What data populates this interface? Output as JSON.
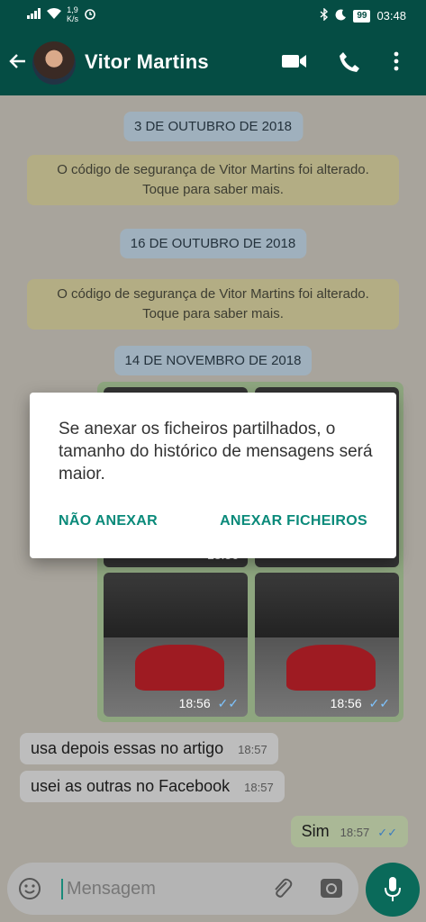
{
  "status_bar": {
    "speed_value": "1,9",
    "speed_unit": "K/s",
    "battery": "99",
    "time": "03:48"
  },
  "header": {
    "contact_name": "Vitor Martins"
  },
  "chat": {
    "dates": [
      "3 DE OUTUBRO DE 2018",
      "16 DE OUTUBRO DE 2018",
      "14 DE NOVEMBRO DE 2018"
    ],
    "system_message_line1": "O código de segurança de Vitor Martins foi alterado.",
    "system_message_line2": "Toque para saber mais.",
    "photo_time_top": "18:56",
    "photo_time_1": "18:56",
    "photo_time_2": "18:56",
    "messages": [
      {
        "text": "usa depois essas no artigo",
        "time": "18:57"
      },
      {
        "text": "usei as outras no Facebook",
        "time": "18:57"
      },
      {
        "text": "Sim",
        "time": "18:57"
      }
    ]
  },
  "input": {
    "placeholder": "Mensagem"
  },
  "dialog": {
    "message": "Se anexar os ficheiros partilhados, o tamanho do histórico de mensagens será maior.",
    "cancel_label": "NÃO ANEXAR",
    "confirm_label": "ANEXAR FICHEIROS"
  },
  "colors": {
    "header_bg": "#054d44",
    "accent": "#0a8a7a",
    "outgoing_bubble": "#dcf8c6",
    "system_bubble": "#fff5c4",
    "date_pill": "#e1f2fb"
  }
}
